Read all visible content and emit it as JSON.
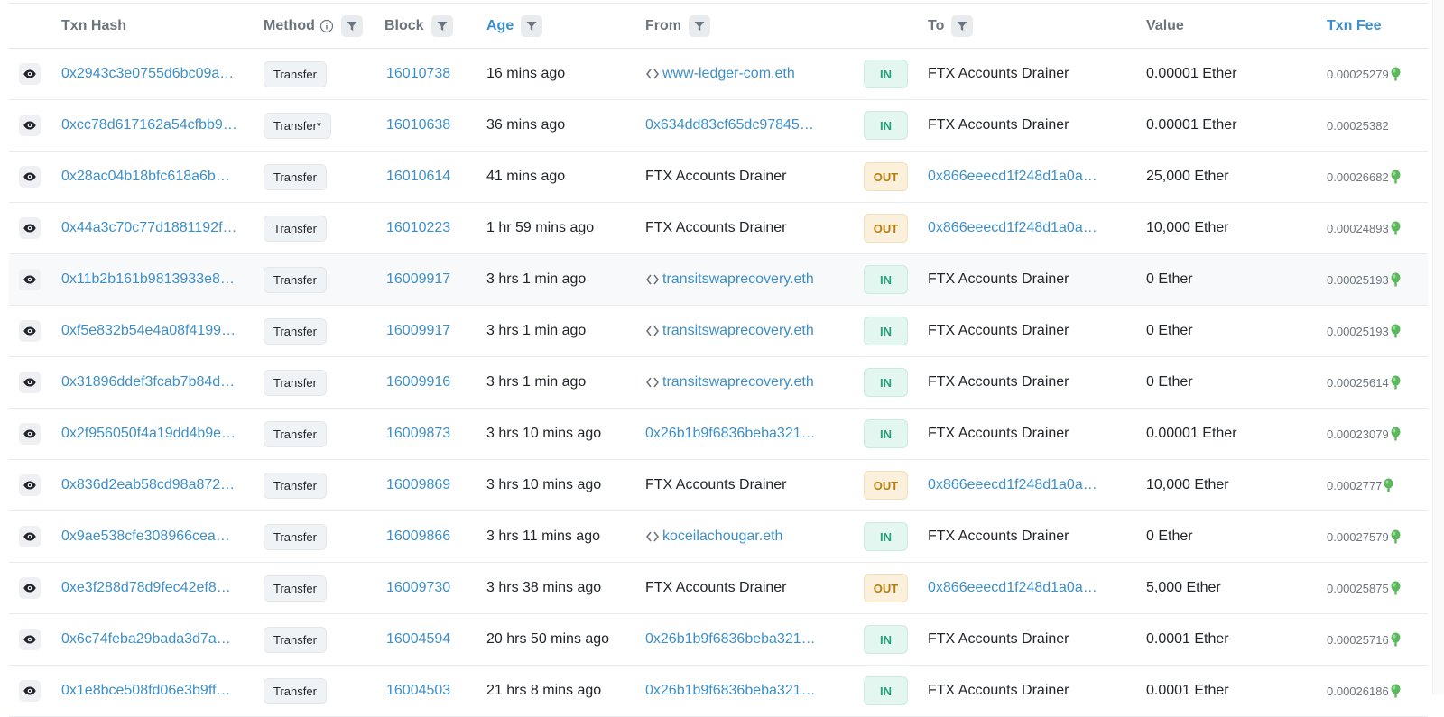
{
  "header": {
    "txn_hash": "Txn Hash",
    "method": "Method",
    "block": "Block",
    "age": "Age",
    "from": "From",
    "to": "To",
    "value": "Value",
    "txn_fee": "Txn Fee"
  },
  "colors": {
    "link": "#3d8fc7",
    "in_badge": "#26a17b",
    "out_badge": "#b47d0e",
    "gas_icon": "#5cb85c"
  },
  "rows": [
    {
      "hash": "0x2943c3e0755d6bc09a…",
      "method": "Transfer",
      "block": "16010738",
      "age": "16 mins ago",
      "from": "www-ledger-com.eth",
      "from_type": "contract",
      "dir": "IN",
      "to": "FTX Accounts Drainer",
      "to_type": "text",
      "value": "0.00001 Ether",
      "fee": "0.00025279",
      "gas_icon": true
    },
    {
      "hash": "0xcc78d617162a54cfbb9…",
      "method": "Transfer*",
      "block": "16010638",
      "age": "36 mins ago",
      "from": "0x634dd83cf65dc97845…",
      "from_type": "link",
      "dir": "IN",
      "to": "FTX Accounts Drainer",
      "to_type": "text",
      "value": "0.00001 Ether",
      "fee": "0.00025382",
      "gas_icon": false
    },
    {
      "hash": "0x28ac04b18bfc618a6b…",
      "method": "Transfer",
      "block": "16010614",
      "age": "41 mins ago",
      "from": "FTX Accounts Drainer",
      "from_type": "text",
      "dir": "OUT",
      "to": "0x866eeecd1f248d1a0a…",
      "to_type": "link",
      "value": "25,000 Ether",
      "fee": "0.00026682",
      "gas_icon": true
    },
    {
      "hash": "0x44a3c70c77d1881192f…",
      "method": "Transfer",
      "block": "16010223",
      "age": "1 hr 59 mins ago",
      "from": "FTX Accounts Drainer",
      "from_type": "text",
      "dir": "OUT",
      "to": "0x866eeecd1f248d1a0a…",
      "to_type": "link",
      "value": "10,000 Ether",
      "fee": "0.00024893",
      "gas_icon": true
    },
    {
      "hash": "0x11b2b161b9813933e8…",
      "method": "Transfer",
      "block": "16009917",
      "age": "3 hrs 1 min ago",
      "from": "transitswaprecovery.eth",
      "from_type": "contract",
      "dir": "IN",
      "to": "FTX Accounts Drainer",
      "to_type": "text",
      "value": "0 Ether",
      "fee": "0.00025193",
      "gas_icon": true
    },
    {
      "hash": "0xf5e832b54e4a08f4199…",
      "method": "Transfer",
      "block": "16009917",
      "age": "3 hrs 1 min ago",
      "from": "transitswaprecovery.eth",
      "from_type": "contract",
      "dir": "IN",
      "to": "FTX Accounts Drainer",
      "to_type": "text",
      "value": "0 Ether",
      "fee": "0.00025193",
      "gas_icon": true
    },
    {
      "hash": "0x31896ddef3fcab7b84d…",
      "method": "Transfer",
      "block": "16009916",
      "age": "3 hrs 1 min ago",
      "from": "transitswaprecovery.eth",
      "from_type": "contract",
      "dir": "IN",
      "to": "FTX Accounts Drainer",
      "to_type": "text",
      "value": "0 Ether",
      "fee": "0.00025614",
      "gas_icon": true
    },
    {
      "hash": "0x2f956050f4a19dd4b9e…",
      "method": "Transfer",
      "block": "16009873",
      "age": "3 hrs 10 mins ago",
      "from": "0x26b1b9f6836beba321…",
      "from_type": "link",
      "dir": "IN",
      "to": "FTX Accounts Drainer",
      "to_type": "text",
      "value": "0.00001 Ether",
      "fee": "0.00023079",
      "gas_icon": true
    },
    {
      "hash": "0x836d2eab58cd98a872…",
      "method": "Transfer",
      "block": "16009869",
      "age": "3 hrs 10 mins ago",
      "from": "FTX Accounts Drainer",
      "from_type": "text",
      "dir": "OUT",
      "to": "0x866eeecd1f248d1a0a…",
      "to_type": "link",
      "value": "10,000 Ether",
      "fee": "0.0002777",
      "gas_icon": true
    },
    {
      "hash": "0x9ae538cfe308966cea…",
      "method": "Transfer",
      "block": "16009866",
      "age": "3 hrs 11 mins ago",
      "from": "koceilachougar.eth",
      "from_type": "contract",
      "dir": "IN",
      "to": "FTX Accounts Drainer",
      "to_type": "text",
      "value": "0 Ether",
      "fee": "0.00027579",
      "gas_icon": true
    },
    {
      "hash": "0xe3f288d78d9fec42ef8…",
      "method": "Transfer",
      "block": "16009730",
      "age": "3 hrs 38 mins ago",
      "from": "FTX Accounts Drainer",
      "from_type": "text",
      "dir": "OUT",
      "to": "0x866eeecd1f248d1a0a…",
      "to_type": "link",
      "value": "5,000 Ether",
      "fee": "0.00025875",
      "gas_icon": true
    },
    {
      "hash": "0x6c74feba29bada3d7a…",
      "method": "Transfer",
      "block": "16004594",
      "age": "20 hrs 50 mins ago",
      "from": "0x26b1b9f6836beba321…",
      "from_type": "link",
      "dir": "IN",
      "to": "FTX Accounts Drainer",
      "to_type": "text",
      "value": "0.0001 Ether",
      "fee": "0.00025716",
      "gas_icon": true
    },
    {
      "hash": "0x1e8bce508fd06e3b9ff…",
      "method": "Transfer",
      "block": "16004503",
      "age": "21 hrs 8 mins ago",
      "from": "0x26b1b9f6836beba321…",
      "from_type": "link",
      "dir": "IN",
      "to": "FTX Accounts Drainer",
      "to_type": "text",
      "value": "0.0001 Ether",
      "fee": "0.00026186",
      "gas_icon": true
    }
  ],
  "highlight_row": 4
}
